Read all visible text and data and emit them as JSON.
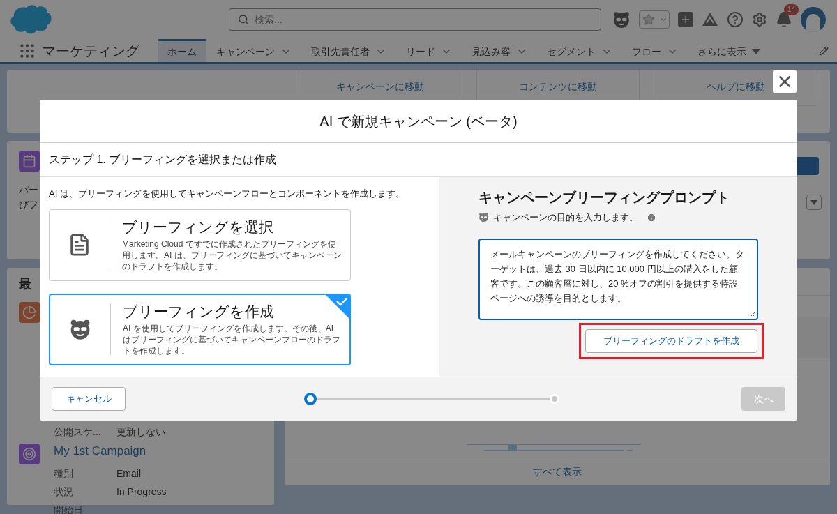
{
  "header": {
    "search": {
      "placeholder": "検索..."
    },
    "notifications": {
      "count": "14"
    }
  },
  "nav": {
    "app_name": "マーケティング",
    "tabs": [
      {
        "label": "ホーム",
        "selected": true,
        "kind": "plain"
      },
      {
        "label": "キャンペーン",
        "selected": false,
        "kind": "menu"
      },
      {
        "label": "取引先責任者",
        "selected": false,
        "kind": "menu"
      },
      {
        "label": "リード",
        "selected": false,
        "kind": "menu"
      },
      {
        "label": "見込み客",
        "selected": false,
        "kind": "menu"
      },
      {
        "label": "セグメント",
        "selected": false,
        "kind": "menu"
      },
      {
        "label": "フロー",
        "selected": false,
        "kind": "menu"
      },
      {
        "label": "さらに表示",
        "selected": false,
        "kind": "more"
      }
    ]
  },
  "background": {
    "quick_links": [
      "キャンペーンに移動",
      "コンテンツに移動",
      "ヘルプに移動"
    ],
    "card_text": [
      "パー",
      "びフ"
    ],
    "recent": {
      "title": "最",
      "top_fields": [
        {
          "label": "公開スケ...",
          "value": "更新しない"
        }
      ],
      "campaign": {
        "name": "My 1st Campaign",
        "fields": [
          {
            "label": "種別",
            "value": "Email"
          },
          {
            "label": "状況",
            "value": "In Progress"
          },
          {
            "label": "開始日"
          }
        ]
      }
    },
    "view_all": "すべて表示"
  },
  "modal": {
    "title": "AI で新規キャンペーン (ベータ)",
    "step": "ステップ 1. ブリーフィングを選択または作成",
    "intro": "AI は、ブリーフィングを使用してキャンペーンフローとコンポーネントを作成します。",
    "options": [
      {
        "kind": "document",
        "title": "ブリーフィングを選択",
        "description": "Marketing Cloud ですでに作成されたブリーフィングを使用します。AI は、ブリーフィングに基づいてキャンペーンのドラフトを作成します。",
        "selected": false
      },
      {
        "kind": "agent",
        "title": "ブリーフィングを作成",
        "description": "AI を使用してブリーフィングを作成します。その後、AI はブリーフィングに基づいてキャンペーンフローのドラフトを作成します。",
        "selected": true
      }
    ],
    "prompt": {
      "title": "キャンペーンブリーフィングプロンプト",
      "hint": "キャンペーンの目的を入力します。",
      "value": "メールキャンペーンのブリーフィングを作成してください。ターゲットは、過去 30 日以内に 10,000 円以上の購入をした顧客です。この顧客層に対し、20 %オフの割引を提供する特設ページへの誘導を目的とします。",
      "draft_button": "ブリーフィングのドラフトを作成",
      "highlighted": true
    },
    "footer": {
      "cancel": "キャンセル",
      "progress": {
        "level": 0
      },
      "next": {
        "label": "次へ",
        "disabled": true
      }
    }
  }
}
